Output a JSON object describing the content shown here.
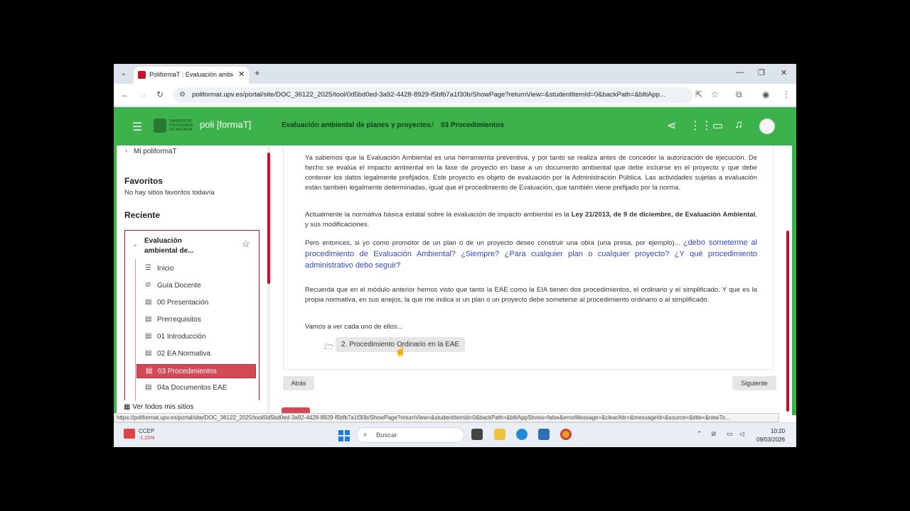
{
  "browser": {
    "tab_title": "PoliformaT : Evaluación ambiental",
    "url": "poliformat.upv.es/portal/site/DOC_36122_2025/tool/0d5bd0ed-3a92-4428-8929-f5bfb7a1f30b/ShowPage?returnView=&studentItemId=0&backPath=&bltiApp...",
    "status_url": "https://poliformat.upv.es/portal/site/DOC_36122_2025/tool/0d5bd0ed-3a92-4428-8929-f5bfb7a1f30b/ShowPage?returnView=&studentItemId=0&backPath=&bltiAppStores=false&errorMessage=&clearAttr=&messageId=&source=&title=&newTo..."
  },
  "header": {
    "logo_university": "UNIVERSITAT POLITÈCNICA DE VALÈNCIA",
    "logo_text": "poli [formaT]",
    "breadcrumb_site": "Evaluación ambiental de planes y proyectos",
    "breadcrumb_sep": "/",
    "breadcrumb_page": "03 Procedimientos"
  },
  "sidebar": {
    "mi_poliformat": "Mi poliformaT",
    "favorites_title": "Favoritos",
    "favorites_empty": "No hay sitios favoritos todavía",
    "recent_title": "Reciente",
    "site_name": "Evaluación ambiental de...",
    "items": [
      {
        "label": "Inicio",
        "icon": "list-icon"
      },
      {
        "label": "Guía Docente",
        "icon": "compass-icon"
      },
      {
        "label": "00 Presentación",
        "icon": "page-icon"
      },
      {
        "label": "Prerrequisitos",
        "icon": "page-icon"
      },
      {
        "label": "01 Introducción",
        "icon": "page-icon"
      },
      {
        "label": "02 EA Normativa",
        "icon": "page-icon"
      },
      {
        "label": "03 Procedimientos",
        "icon": "page-icon",
        "active": true
      },
      {
        "label": "04a Documentos EAE",
        "icon": "page-icon"
      }
    ],
    "all_sites": "Ver todos mis sitios"
  },
  "content": {
    "p1": "Ya sabemos que la Evaluación Ambiental es una herramienta preventiva, y por tanto se realiza antes de conceder la autorización de ejecución. De hecho se evalúa el impacto ambiental en la fase de proyecto en base a un documento ambiental que debe incluirse en el proyecto y que debe contener los datos legalmente prefijados. Este proyecto es objeto de evaluación por la Administración Pública. Las actividades sujetas a evaluación están también legalmente determinadas, igual que el procedimiento de Evaluación, que también viene prefijado por la norma.",
    "p2_pre": "Actualmente la normativa básica estatal sobre la evaluación de impacto ambiental es la ",
    "p2_bold": "Ley 21/2013, de 9 de diciembre, de Evaluación Ambiental",
    "p2_post": ", y sus modificaciones.",
    "p3_pre": "Pero entonces, si yo como promotor de un plan o de un proyecto deseo construir una obra (una presa, por ejemplo)... ",
    "p3_question": "¿debo someterme al procedimiento de Evaluación Ambiental? ¿Siempre? ¿Para cualquier plan o cualquier proyecto? ¿Y qué procedimiento administrativo debo seguir?",
    "p4": "Recuerda que en el módulo anterior hemos visto que tanto la EAE como la EIA tienen dos procedimientos, el ordinario y el simplificado. Y que es la propia normativa, en sus anejos, la que me indica si un plan o un proyecto debe someterse al procedimiento ordinario o al simplificado.",
    "p5": "Vamos a ver cada uno de ellos...",
    "folder_button": "2. Procedimiento Ordinario en la EAE",
    "back_button": "Atrás",
    "next_button": "Siguiente"
  },
  "taskbar": {
    "ticker_name": "CCEP",
    "ticker_change": "-1,15%",
    "search_placeholder": "Buscar",
    "time": "10:20",
    "date": "09/03/2026"
  }
}
